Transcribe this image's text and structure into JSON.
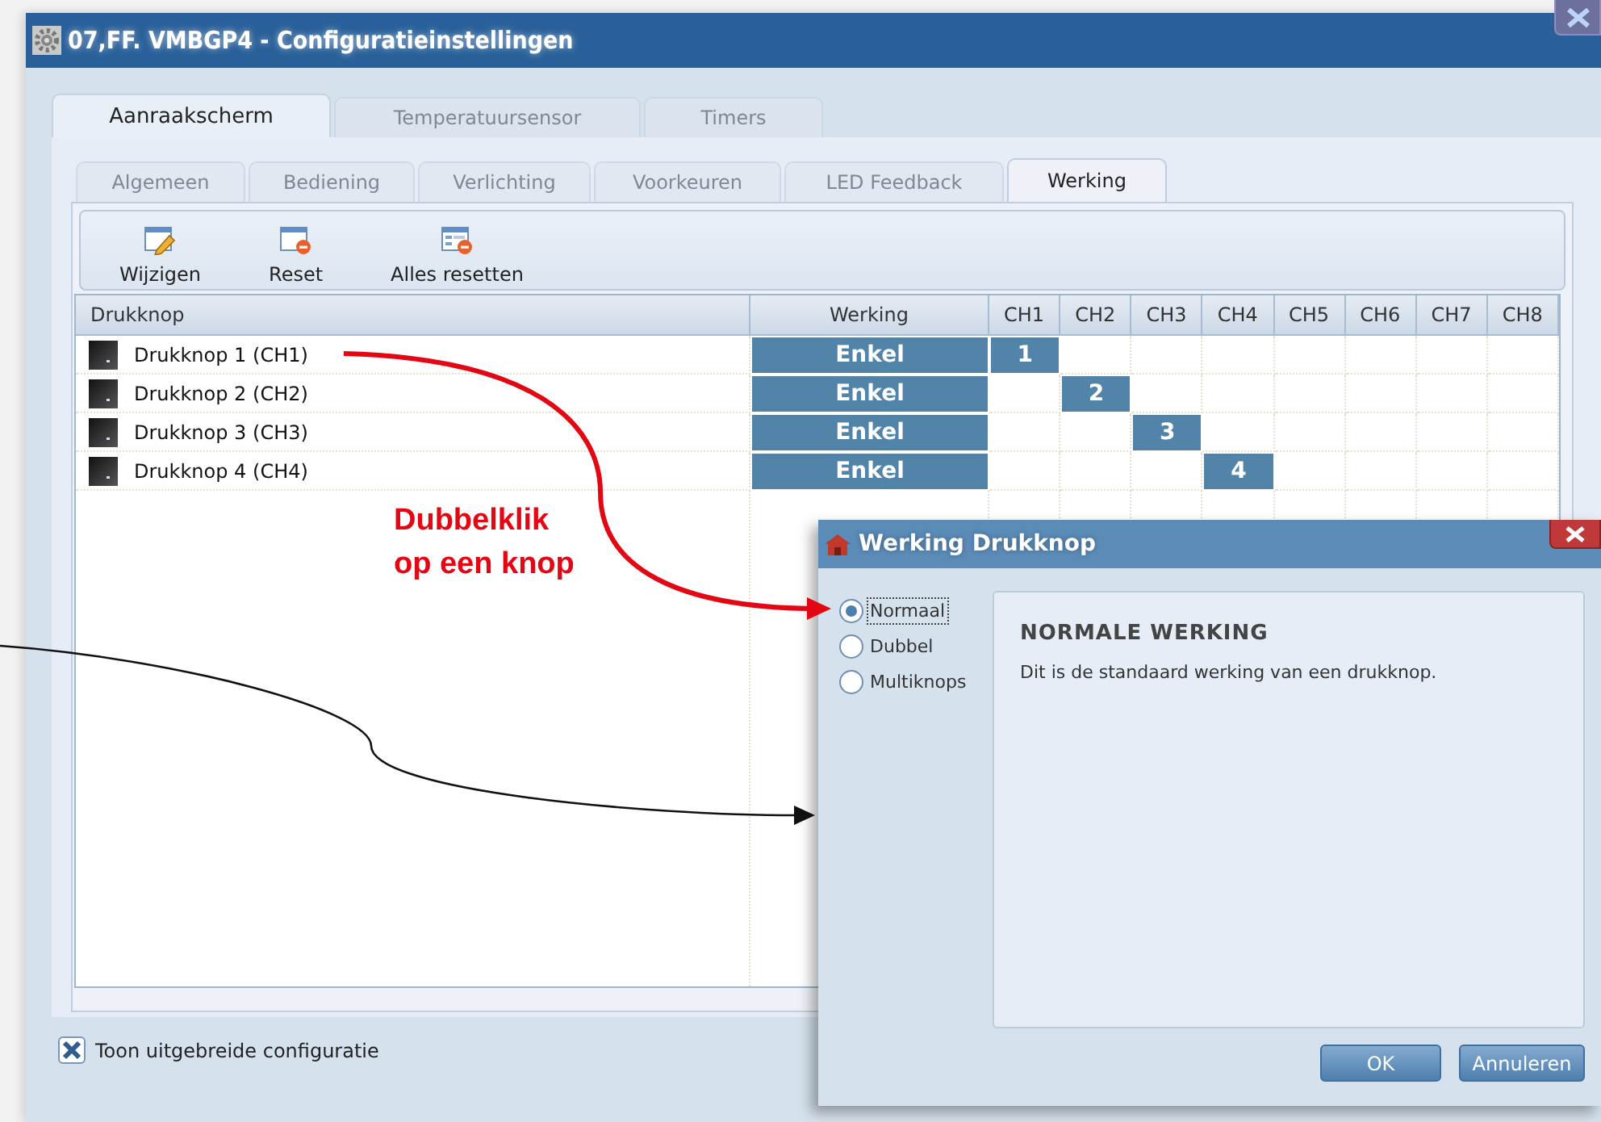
{
  "window": {
    "title": "07,FF. VMBGP4 - Configuratieinstellingen"
  },
  "tabs": [
    {
      "label": "Aanraakscherm",
      "selected": true
    },
    {
      "label": "Temperatuursensor",
      "selected": false
    },
    {
      "label": "Timers",
      "selected": false
    }
  ],
  "subtabs": [
    {
      "label": "Algemeen",
      "selected": false
    },
    {
      "label": "Bediening",
      "selected": false
    },
    {
      "label": "Verlichting",
      "selected": false
    },
    {
      "label": "Voorkeuren",
      "selected": false
    },
    {
      "label": "LED Feedback",
      "selected": false
    },
    {
      "label": "Werking",
      "selected": true
    }
  ],
  "toolbar": [
    {
      "label": "Wijzigen",
      "kind": "edit"
    },
    {
      "label": "Reset",
      "kind": "reset"
    },
    {
      "label": "Alles resetten",
      "kind": "reset-all"
    }
  ],
  "table": {
    "columns": [
      "Drukknop",
      "Werking",
      "CH1",
      "CH2",
      "CH3",
      "CH4",
      "CH5",
      "CH6",
      "CH7",
      "CH8"
    ],
    "rows": [
      {
        "name": "Drukknop 1 (CH1)",
        "mode": "Enkel",
        "channels": [
          {
            "active": true,
            "text": "1"
          },
          {
            "active": false
          },
          {
            "active": false
          },
          {
            "active": false
          },
          {
            "active": false
          },
          {
            "active": false
          },
          {
            "active": false
          },
          {
            "active": false
          }
        ]
      },
      {
        "name": "Drukknop 2 (CH2)",
        "mode": "Enkel",
        "channels": [
          {
            "active": false
          },
          {
            "active": true,
            "text": "2"
          },
          {
            "active": false
          },
          {
            "active": false
          },
          {
            "active": false
          },
          {
            "active": false
          },
          {
            "active": false
          },
          {
            "active": false
          }
        ]
      },
      {
        "name": "Drukknop 3 (CH3)",
        "mode": "Enkel",
        "channels": [
          {
            "active": false
          },
          {
            "active": false
          },
          {
            "active": true,
            "text": "3"
          },
          {
            "active": false
          },
          {
            "active": false
          },
          {
            "active": false
          },
          {
            "active": false
          },
          {
            "active": false
          }
        ]
      },
      {
        "name": "Drukknop 4 (CH4)",
        "mode": "Enkel",
        "channels": [
          {
            "active": false
          },
          {
            "active": false
          },
          {
            "active": false
          },
          {
            "active": true,
            "text": "4"
          },
          {
            "active": false
          },
          {
            "active": false
          },
          {
            "active": false
          },
          {
            "active": false
          }
        ]
      }
    ]
  },
  "extended_config": {
    "label": "Toon uitgebreide configuratie",
    "checked": true
  },
  "dialog": {
    "title": "Werking Drukknop",
    "options": [
      {
        "label": "Normaal",
        "selected": true
      },
      {
        "label": "Dubbel",
        "selected": false
      },
      {
        "label": "Multiknops",
        "selected": false
      }
    ],
    "description": {
      "heading": "NORMALE WERKING",
      "text": "Dit is de standaard werking van een drukknop."
    },
    "buttons": [
      "OK",
      "Annuleren"
    ]
  },
  "annotation": {
    "text": "Dubbelklik op een knop"
  }
}
